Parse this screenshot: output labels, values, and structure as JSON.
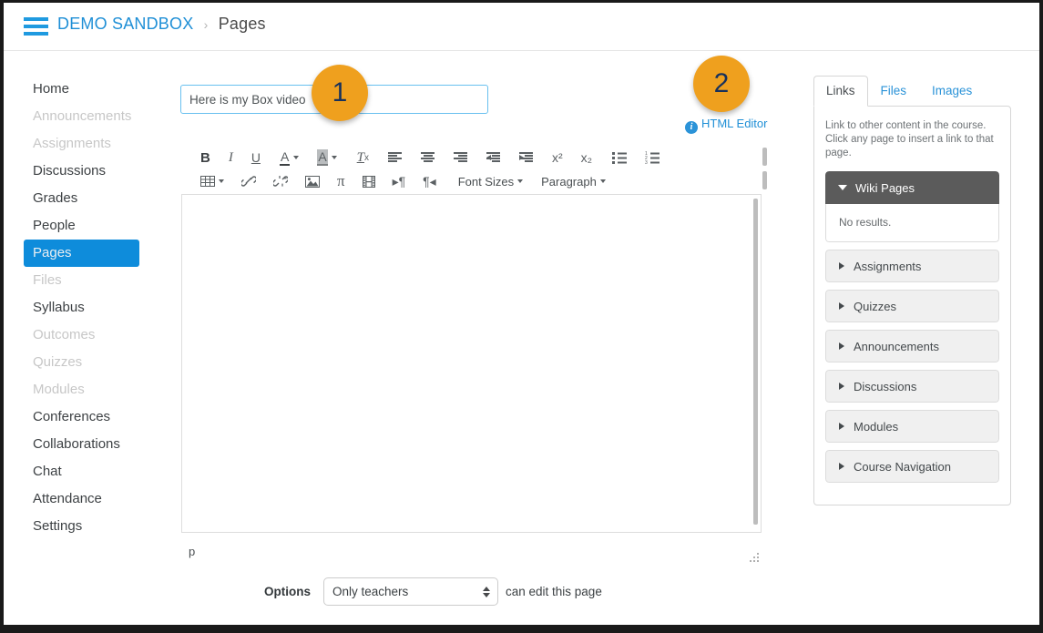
{
  "header": {
    "menu_icon": "hamburger-menu-icon",
    "course": "DEMO SANDBOX",
    "separator": "›",
    "current": "Pages"
  },
  "sidebar": {
    "items": [
      {
        "label": "Home",
        "state": "normal"
      },
      {
        "label": "Announcements",
        "state": "muted"
      },
      {
        "label": "Assignments",
        "state": "muted"
      },
      {
        "label": "Discussions",
        "state": "normal"
      },
      {
        "label": "Grades",
        "state": "normal"
      },
      {
        "label": "People",
        "state": "normal"
      },
      {
        "label": "Pages",
        "state": "active"
      },
      {
        "label": "Files",
        "state": "muted"
      },
      {
        "label": "Syllabus",
        "state": "normal"
      },
      {
        "label": "Outcomes",
        "state": "muted"
      },
      {
        "label": "Quizzes",
        "state": "muted"
      },
      {
        "label": "Modules",
        "state": "muted"
      },
      {
        "label": "Conferences",
        "state": "normal"
      },
      {
        "label": "Collaborations",
        "state": "normal"
      },
      {
        "label": "Chat",
        "state": "normal"
      },
      {
        "label": "Attendance",
        "state": "normal"
      },
      {
        "label": "Settings",
        "state": "normal"
      }
    ]
  },
  "editor": {
    "title_value": "Here is my Box video",
    "title_placeholder": "Page Title",
    "html_editor_link": "HTML Editor",
    "html_editor_icon": "info-icon",
    "body_value": "",
    "path_indicator": "p",
    "toolbar_row1": [
      {
        "name": "bold-button",
        "glyph": "B",
        "style": "bold"
      },
      {
        "name": "italic-button",
        "glyph": "I",
        "style": "italic"
      },
      {
        "name": "underline-button",
        "glyph": "U",
        "style": "underline"
      },
      {
        "name": "text-color-button",
        "glyph": "A",
        "style": "color"
      },
      {
        "name": "background-color-button",
        "glyph": "A",
        "style": "highlight"
      },
      {
        "name": "clear-formatting-button",
        "glyph": "Tx",
        "style": "clear"
      },
      {
        "name": "align-left-button",
        "glyph": "align-left",
        "style": "icon"
      },
      {
        "name": "align-center-button",
        "glyph": "align-center",
        "style": "icon"
      },
      {
        "name": "align-right-button",
        "glyph": "align-right",
        "style": "icon"
      },
      {
        "name": "outdent-button",
        "glyph": "outdent",
        "style": "icon"
      },
      {
        "name": "indent-button",
        "glyph": "indent",
        "style": "icon"
      },
      {
        "name": "superscript-button",
        "glyph": "x²",
        "style": "script"
      },
      {
        "name": "subscript-button",
        "glyph": "x₂",
        "style": "script"
      },
      {
        "name": "bulleted-list-button",
        "glyph": "bullet-list",
        "style": "icon"
      },
      {
        "name": "numbered-list-button",
        "glyph": "number-list",
        "style": "icon"
      }
    ],
    "toolbar_row2": [
      {
        "name": "table-button",
        "glyph": "table",
        "style": "icon"
      },
      {
        "name": "link-button",
        "glyph": "link",
        "style": "icon"
      },
      {
        "name": "unlink-button",
        "glyph": "unlink",
        "style": "icon"
      },
      {
        "name": "insert-image-button",
        "glyph": "image",
        "style": "icon"
      },
      {
        "name": "equation-button",
        "glyph": "π",
        "style": "pi"
      },
      {
        "name": "insert-media-button",
        "glyph": "film",
        "style": "icon"
      },
      {
        "name": "ltr-button",
        "glyph": "ltr",
        "style": "icon"
      },
      {
        "name": "rtl-button",
        "glyph": "rtl",
        "style": "icon"
      }
    ],
    "font_sizes_label": "Font Sizes",
    "paragraph_label": "Paragraph"
  },
  "options": {
    "label": "Options",
    "selected": "Only teachers",
    "suffix": "can edit this page"
  },
  "right_panel": {
    "tabs": [
      {
        "label": "Links",
        "active": true
      },
      {
        "label": "Files",
        "active": false
      },
      {
        "label": "Images",
        "active": false
      }
    ],
    "help_text": "Link to other content in the course. Click any page to insert a link to that page.",
    "accordions": [
      {
        "label": "Wiki Pages",
        "open": true,
        "content": "No results."
      },
      {
        "label": "Assignments",
        "open": false,
        "content": ""
      },
      {
        "label": "Quizzes",
        "open": false,
        "content": ""
      },
      {
        "label": "Announcements",
        "open": false,
        "content": ""
      },
      {
        "label": "Discussions",
        "open": false,
        "content": ""
      },
      {
        "label": "Modules",
        "open": false,
        "content": ""
      },
      {
        "label": "Course Navigation",
        "open": false,
        "content": ""
      }
    ]
  },
  "callouts": [
    {
      "number": "1"
    },
    {
      "number": "2"
    }
  ],
  "colors": {
    "accent_blue": "#1f8fd6",
    "active_nav_blue": "#0e8cdb",
    "callout_orange": "#efa01e",
    "callout_number": "#17315c",
    "accordion_open": "#5b5b5b"
  }
}
